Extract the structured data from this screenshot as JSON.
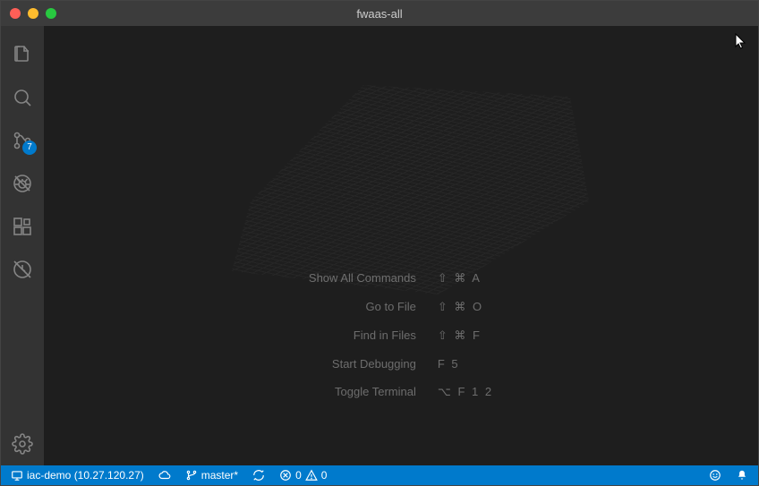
{
  "window": {
    "title": "fwaas-all"
  },
  "activitybar": {
    "scm_badge": "7"
  },
  "shortcuts": [
    {
      "label": "Show All Commands",
      "keys": "⇧ ⌘ A"
    },
    {
      "label": "Go to File",
      "keys": "⇧ ⌘ O"
    },
    {
      "label": "Find in Files",
      "keys": "⇧ ⌘ F"
    },
    {
      "label": "Start Debugging",
      "keys": "F 5"
    },
    {
      "label": "Toggle Terminal",
      "keys": "⌥ F 1 2"
    }
  ],
  "statusbar": {
    "remote": "iac-demo (10.27.120.27)",
    "branch": "master*",
    "errors": "0",
    "warnings": "0"
  }
}
